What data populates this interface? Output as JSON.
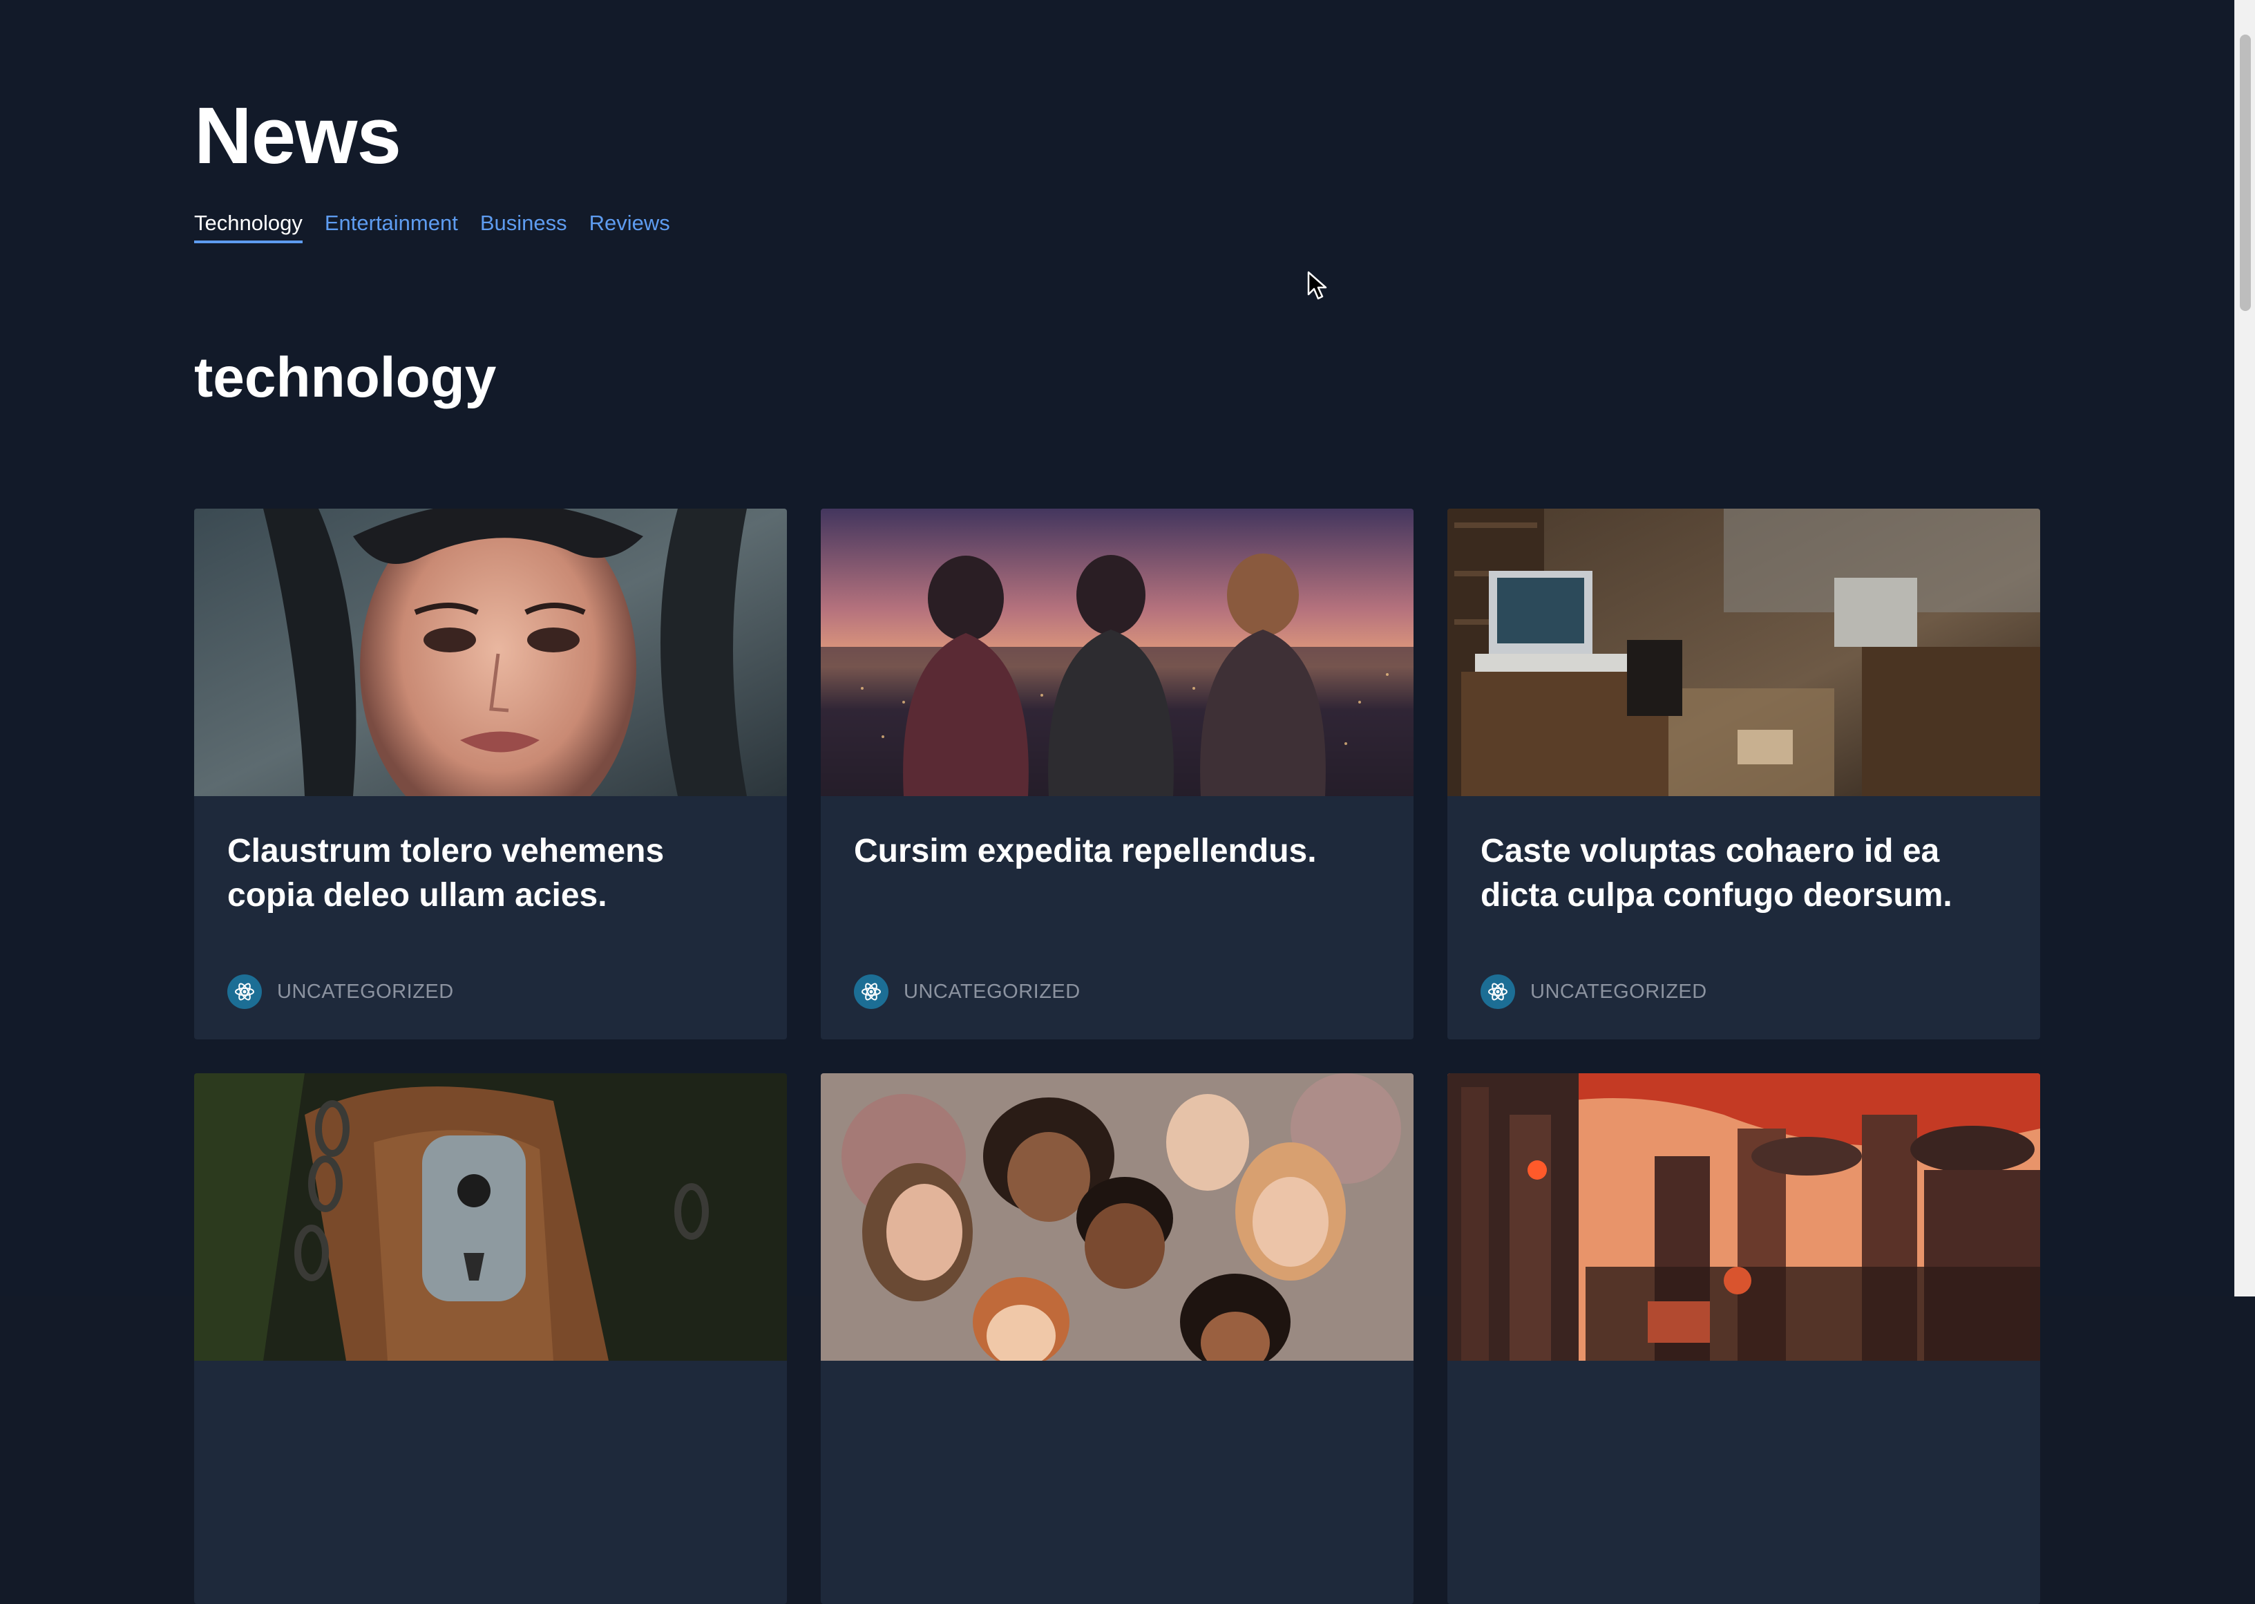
{
  "header": {
    "title": "News"
  },
  "tabs": [
    {
      "label": "Technology",
      "active": true
    },
    {
      "label": "Entertainment",
      "active": false
    },
    {
      "label": "Business",
      "active": false
    },
    {
      "label": "Reviews",
      "active": false
    }
  ],
  "section": {
    "title": "technology"
  },
  "cards": [
    {
      "title": "Claustrum tolero vehemens copia deleo ullam acies.",
      "category": "UNCATEGORIZED",
      "image": "crying-woman-portrait"
    },
    {
      "title": "Cursim expedita repellendus.",
      "category": "UNCATEGORIZED",
      "image": "three-women-city-sunset"
    },
    {
      "title": "Caste voluptas cohaero id ea dicta culpa confugo deorsum.",
      "category": "UNCATEGORIZED",
      "image": "abandoned-computer-office"
    },
    {
      "image": "rusty-padlock-chains"
    },
    {
      "image": "group-of-children-cartoon"
    },
    {
      "image": "steampunk-city-red-sky"
    }
  ],
  "icons": {
    "category": "react-atom-icon"
  },
  "colors": {
    "background": "#121a29",
    "card": "#1e293b",
    "link": "#5e9cf0",
    "category_icon": "#1c6e95"
  }
}
